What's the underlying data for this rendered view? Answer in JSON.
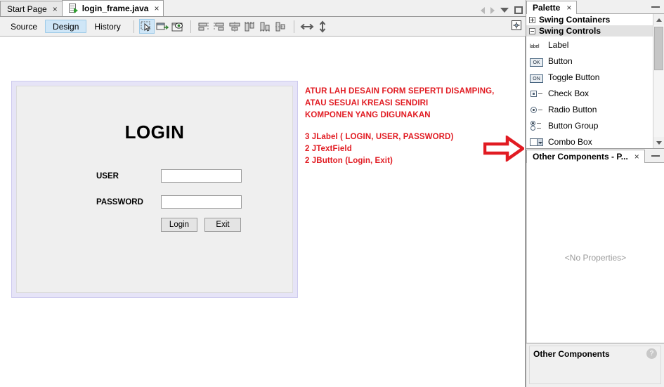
{
  "window": {
    "doc_tabs": [
      {
        "label": "Start Page",
        "close": "×",
        "active": false,
        "icon": "none"
      },
      {
        "label": "login_frame.java",
        "close": "×",
        "active": true,
        "icon": "java-file-icon"
      }
    ],
    "tabbar_controls": [
      {
        "name": "nav-back-icon"
      },
      {
        "name": "nav-forward-icon"
      },
      {
        "name": "tab-list-dropdown-icon"
      },
      {
        "name": "maximize-window-icon"
      }
    ]
  },
  "design_toolbar": {
    "view_tabs": [
      {
        "label": "Source",
        "selected": false
      },
      {
        "label": "Design",
        "selected": true
      },
      {
        "label": "History",
        "selected": false
      }
    ],
    "tools": [
      {
        "name": "selection-tool-icon",
        "active": true
      },
      {
        "name": "connection-mode-icon",
        "active": false
      },
      {
        "name": "preview-design-icon",
        "active": false
      },
      {
        "name": "align-left-icon",
        "active": false
      },
      {
        "name": "align-right-icon",
        "active": false
      },
      {
        "name": "align-center-horizontal-icon",
        "active": false
      },
      {
        "name": "align-top-icon",
        "active": false
      },
      {
        "name": "align-bottom-icon",
        "active": false
      },
      {
        "name": "align-center-vertical-icon",
        "active": false
      },
      {
        "name": "resize-horizontal-icon",
        "active": false
      },
      {
        "name": "resize-vertical-icon",
        "active": false
      }
    ],
    "end_icon": "auto-resizing-icon"
  },
  "form": {
    "title": "LOGIN",
    "fields": [
      {
        "label": "USER",
        "value": "",
        "name": "user-textfield"
      },
      {
        "label": "PASSWORD",
        "value": "",
        "name": "password-textfield"
      }
    ],
    "buttons": [
      {
        "label": "Login",
        "name": "login-button"
      },
      {
        "label": "Exit",
        "name": "exit-button"
      }
    ]
  },
  "annotation": {
    "color": "#e11b22",
    "block1": [
      "ATUR LAH DESAIN FORM SEPERTI DISAMPING,",
      "ATAU SESUAI KREASI SENDIRI",
      "KOMPONEN YANG DIGUNAKAN"
    ],
    "block2": [
      "3 JLabel ( LOGIN, USER, PASSWORD)",
      "2 JTextField",
      "2 JButton (Login, Exit)"
    ],
    "arrow": "right-arrow-annotation"
  },
  "palette": {
    "title": "Palette",
    "close": "×",
    "minimize": "minimize-icon",
    "categories": [
      {
        "label": "Swing Containers",
        "expanded": false,
        "selected": false
      },
      {
        "label": "Swing Controls",
        "expanded": true,
        "selected": true
      }
    ],
    "items": [
      {
        "label": "Label",
        "icon": "label-icon"
      },
      {
        "label": "Button",
        "icon": "button-icon"
      },
      {
        "label": "Toggle Button",
        "icon": "toggle-button-icon"
      },
      {
        "label": "Check Box",
        "icon": "check-box-icon"
      },
      {
        "label": "Radio Button",
        "icon": "radio-button-icon"
      },
      {
        "label": "Button Group",
        "icon": "button-group-icon"
      },
      {
        "label": "Combo Box",
        "icon": "combo-box-icon"
      }
    ]
  },
  "properties": {
    "title": "Other Components - P...",
    "close": "×",
    "minimize": "minimize-icon",
    "empty_text": "<No Properties>"
  },
  "other_components": {
    "title": "Other Components",
    "help": "?"
  },
  "colors": {
    "accent": "#cfe6f7",
    "annotation_red": "#e11b22",
    "form_border": "#e6e4f7",
    "panel_bg": "#f0f0f0"
  }
}
